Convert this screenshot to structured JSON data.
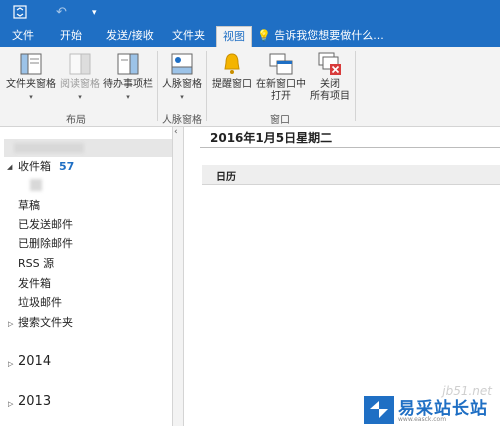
{
  "titlebar": {
    "app_icon": "outlook-send-receive-icon",
    "undo_icon": "undo-icon",
    "customize_icon": "qat-dropdown-icon"
  },
  "tabs": [
    {
      "label": "文件"
    },
    {
      "label": "开始"
    },
    {
      "label": "发送/接收"
    },
    {
      "label": "文件夹"
    },
    {
      "label": "视图",
      "active": true
    }
  ],
  "tell_me": "告诉我您想要做什么...",
  "ribbon": {
    "groups": [
      {
        "label": "布局"
      },
      {
        "label": "人脉窗格"
      },
      {
        "label": "窗口"
      }
    ],
    "buttons": {
      "folder_pane": "文件夹窗格",
      "reading_pane": "阅读窗格",
      "todo_bar": "待办事项栏",
      "people_pane": "人脉窗格",
      "reminders": "提醒窗口",
      "open_new_line1": "在新窗口中",
      "open_new_line2": "打开",
      "close_all_line1": "关闭",
      "close_all_line2": "所有项目"
    }
  },
  "folders": {
    "inbox": "收件箱",
    "inbox_count": "57",
    "drafts": "草稿",
    "sent": "已发送邮件",
    "deleted": "已删除邮件",
    "rss": "RSS 源",
    "outbox": "发件箱",
    "junk": "垃圾邮件",
    "search": "搜索文件夹"
  },
  "years": [
    "2014",
    "2013"
  ],
  "main": {
    "date_header": "2016年1月5日星期二",
    "calendar_label": "日历"
  },
  "watermark": {
    "site": "jb51.net",
    "brand": "易采站长站",
    "sub": "www.easck.com"
  },
  "colors": {
    "accent": "#1f6fc4",
    "ribbon_bg": "#f3f3f3"
  }
}
